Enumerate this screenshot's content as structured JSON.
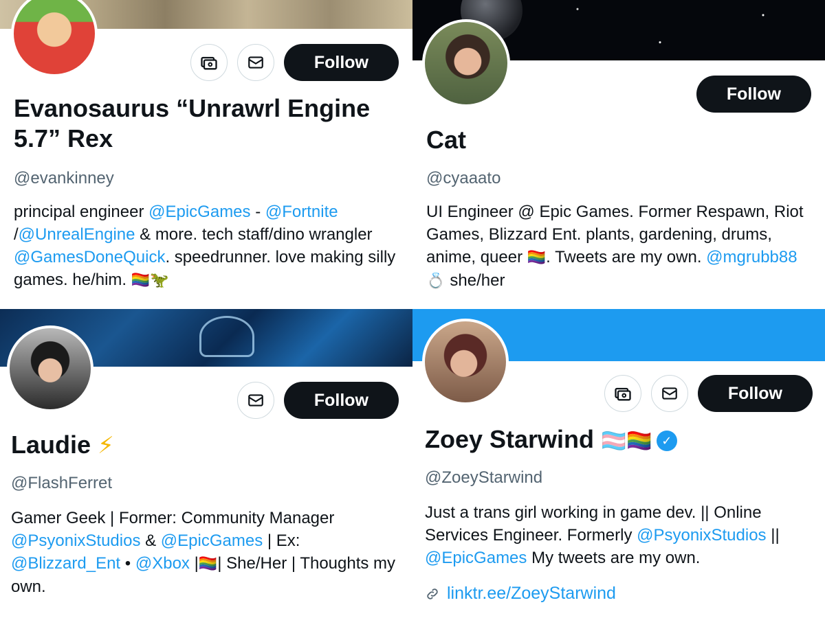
{
  "profiles": [
    {
      "name": "Evanosaurus “Unrawrl Engine 5.7” Rex",
      "handle": "@evankinney",
      "follow_label": "Follow",
      "bio": {
        "t1": "principal engineer ",
        "l1": "@EpicGames",
        "t2": " - ",
        "l2": "@Fortnite",
        "t3": " /",
        "l3": "@UnrealEngine",
        "t4": " & more. tech staff/dino wrangler ",
        "l4": "@GamesDoneQuick",
        "t5": ". speedrunner. love making silly games. he/him. ",
        "emoji": "🏳️‍🌈🦖"
      }
    },
    {
      "name": "Cat",
      "handle": "@cyaaato",
      "follow_label": "Follow",
      "bio": {
        "t1": "UI Engineer @ Epic Games. Former Respawn, Riot Games, Blizzard Ent. plants, gardening, drums, anime, queer ",
        "emoji1": "🏳️‍🌈",
        "t2": ". Tweets are my own. ",
        "l1": "@mgrubb88",
        "emoji2": " 💍 ",
        "t3": " she/her"
      }
    },
    {
      "name": "Laudie",
      "name_emoji": "⚡",
      "handle": "@FlashFerret",
      "follow_label": "Follow",
      "bio": {
        "t1": "Gamer Geek | Former: Community Manager ",
        "l1": "@PsyonixStudios",
        "t2": " & ",
        "l2": "@EpicGames",
        "t3": " | Ex: ",
        "l3": "@Blizzard_Ent",
        "t4": " • ",
        "l4": "@Xbox",
        "t5": " |",
        "emoji": "🏳️‍🌈",
        "t6": "| She/Her | Thoughts my own."
      }
    },
    {
      "name": "Zoey Starwind",
      "name_emoji": "🏳️‍⚧️🏳️‍🌈",
      "verified": "✓",
      "handle": "@ZoeyStarwind",
      "follow_label": "Follow",
      "bio": {
        "t1": "Just a trans girl working in game dev. || Online Services Engineer. Formerly ",
        "l1": "@PsyonixStudios",
        "t2": " || ",
        "l2": "@EpicGames",
        "t3": "  My tweets are my own."
      },
      "website": "linktr.ee/ZoeyStarwind"
    }
  ],
  "icons": {
    "subscribe": "subscription-icon",
    "message": "mail-icon",
    "link": "link-icon"
  }
}
